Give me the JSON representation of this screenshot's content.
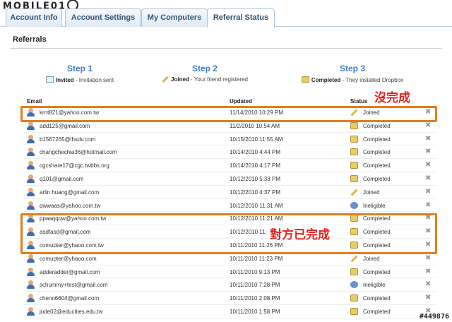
{
  "watermark_logo": "MOBILE01",
  "watermark_id": "#449876",
  "tabs": [
    {
      "label": "Account Info",
      "active": false
    },
    {
      "label": "Account Settings",
      "active": false
    },
    {
      "label": "My Computers",
      "active": false
    },
    {
      "label": "Referral Status",
      "active": true
    }
  ],
  "section_title": "Referrals",
  "steps": [
    {
      "title": "Step 1",
      "bold": "Invited",
      "desc": "- Invitation sent",
      "icon": "envelope-icon"
    },
    {
      "title": "Step 2",
      "bold": "Joined",
      "desc": "- Your friend registered",
      "icon": "pencil-icon"
    },
    {
      "title": "Step 3",
      "bold": "Completed",
      "desc": "- They installed Dropbox",
      "icon": "dropbox-icon"
    }
  ],
  "table": {
    "headers": {
      "email": "Email",
      "updated": "Updated",
      "status": "Status"
    },
    "rows": [
      {
        "email": "krnt821@yahoo.com.tw",
        "updated": "11/14/2010 10:29 PM",
        "status": "Joined"
      },
      {
        "email": "add125@gmail.com",
        "updated": "11/2/2010 10:54 AM",
        "status": "Completed"
      },
      {
        "email": "b1567265@lhsdv.com",
        "updated": "10/15/2010 11:55 AM",
        "status": "Completed"
      },
      {
        "email": "changchechia36@hotmail.com",
        "updated": "10/14/2010 4:44 PM",
        "status": "Completed"
      },
      {
        "email": "cgcshare17@cgc.twbbs.org",
        "updated": "10/14/2010 4:17 PM",
        "status": "Completed"
      },
      {
        "email": "q101@gmail.com",
        "updated": "10/12/2010 5:33 PM",
        "status": "Completed"
      },
      {
        "email": "arlin.huang@gmail.com",
        "updated": "10/12/2010 4:37 PM",
        "status": "Joined"
      },
      {
        "email": "qwwaas@yahoo.com.tw",
        "updated": "10/12/2010 11:31 AM",
        "status": "Ineligible"
      },
      {
        "email": "ppaaqqqw@yahoo.com.tw",
        "updated": "10/12/2010 11:21 AM",
        "status": "Completed"
      },
      {
        "email": "asdfasd@gmail.com",
        "updated": "10/12/2010 11:",
        "status": "Completed"
      },
      {
        "email": "comupter@yhaoo.com.tw",
        "updated": "10/11/2010 11:26 PM",
        "status": "Completed"
      },
      {
        "email": "comupter@yhaoo.com",
        "updated": "10/11/2010 11:23 PM",
        "status": "Joined"
      },
      {
        "email": "adderadder@gmail.com",
        "updated": "10/11/2010 9:13 PM",
        "status": "Completed"
      },
      {
        "email": "schummy+test@gmail.com",
        "updated": "10/11/2010 7:28 PM",
        "status": "Ineligible"
      },
      {
        "email": "cheno6604@gmail.com",
        "updated": "10/11/2010 2:08 PM",
        "status": "Completed"
      },
      {
        "email": "jude02@educities.edu.tw",
        "updated": "10/11/2010 1:58 PM",
        "status": "Completed"
      }
    ]
  },
  "annotations": {
    "not_completed": "沒完成",
    "other_party_completed": "對方已完成"
  },
  "colors": {
    "highlight": "#e07f1c",
    "annotation": "#e3251c",
    "step_title": "#3d7cc9"
  }
}
